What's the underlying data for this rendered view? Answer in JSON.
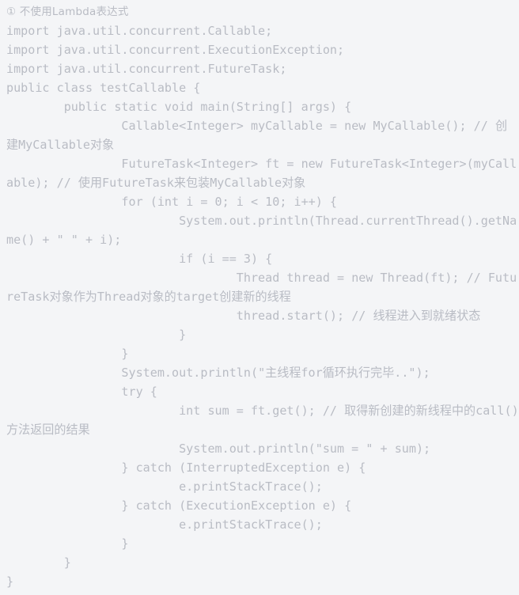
{
  "heading": {
    "marker": "①",
    "text": "① 不使用Lambda表达式"
  },
  "colors": {
    "background": "#f4f5f7",
    "text": "#b9bcc4"
  },
  "code": {
    "language": "java",
    "lines": [
      "import java.util.concurrent.Callable;",
      "import java.util.concurrent.ExecutionException;",
      "import java.util.concurrent.FutureTask;",
      "public class testCallable {",
      "        public static void main(String[] args) {",
      "                Callable<Integer> myCallable = new MyCallable(); // 创建MyCallable对象",
      "                FutureTask<Integer> ft = new FutureTask<Integer>(myCallable); // 使用FutureTask来包装MyCallable对象",
      "                for (int i = 0; i < 10; i++) {",
      "                        System.out.println(Thread.currentThread().getName() + \" \" + i);",
      "                        if (i == 3) {",
      "                                Thread thread = new Thread(ft); // FutureTask对象作为Thread对象的target创建新的线程",
      "                                thread.start(); // 线程进入到就绪状态",
      "                        }",
      "                }",
      "                System.out.println(\"主线程for循环执行完毕..\");",
      "                try {",
      "                        int sum = ft.get(); // 取得新创建的新线程中的call()方法返回的结果",
      "                        System.out.println(\"sum = \" + sum);",
      "                } catch (InterruptedException e) {",
      "                        e.printStackTrace();",
      "                } catch (ExecutionException e) {",
      "                        e.printStackTrace();",
      "                }",
      "        }",
      "}"
    ]
  }
}
